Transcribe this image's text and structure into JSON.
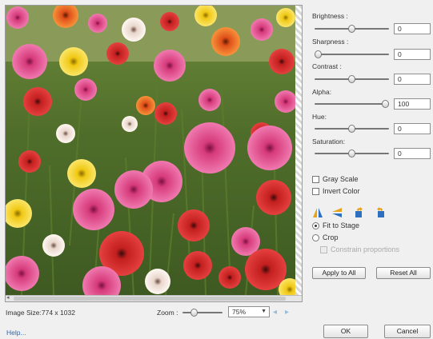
{
  "controls": {
    "brightness": {
      "label": "Brightness :",
      "value": "0",
      "level": 0.5
    },
    "sharpness": {
      "label": "Sharpness :",
      "value": "0",
      "level": 0.0
    },
    "contrast": {
      "label": "Contrast :",
      "value": "0",
      "level": 0.5
    },
    "alpha": {
      "label": "Alpha:",
      "value": "100",
      "level": 1.0
    },
    "hue": {
      "label": "Hue:",
      "value": "0",
      "level": 0.5
    },
    "saturation": {
      "label": "Saturation:",
      "value": "0",
      "level": 0.5
    }
  },
  "options": {
    "gray_scale": "Gray Scale",
    "invert_color": "Invert Color",
    "fit_to_stage": "Fit to Stage",
    "crop": "Crop",
    "constrain_proportions": "Constrain proportions"
  },
  "icons": [
    "flip-horizontal-icon",
    "flip-vertical-icon",
    "rotate-left-icon",
    "rotate-right-icon"
  ],
  "buttons": {
    "apply_to_all": "Apply to All",
    "reset_all": "Reset All",
    "ok": "OK",
    "cancel": "Cancel"
  },
  "status": {
    "image_size": "Image Size:774 x 1032",
    "zoom_label": "Zoom :",
    "zoom_value": "75%",
    "zoom_level": 0.25,
    "help": "Help..."
  },
  "colors": {
    "accent_link": "#2a67b1",
    "flip_icon_orange": "#e8a21c",
    "flip_icon_blue": "#2f6fbf"
  }
}
